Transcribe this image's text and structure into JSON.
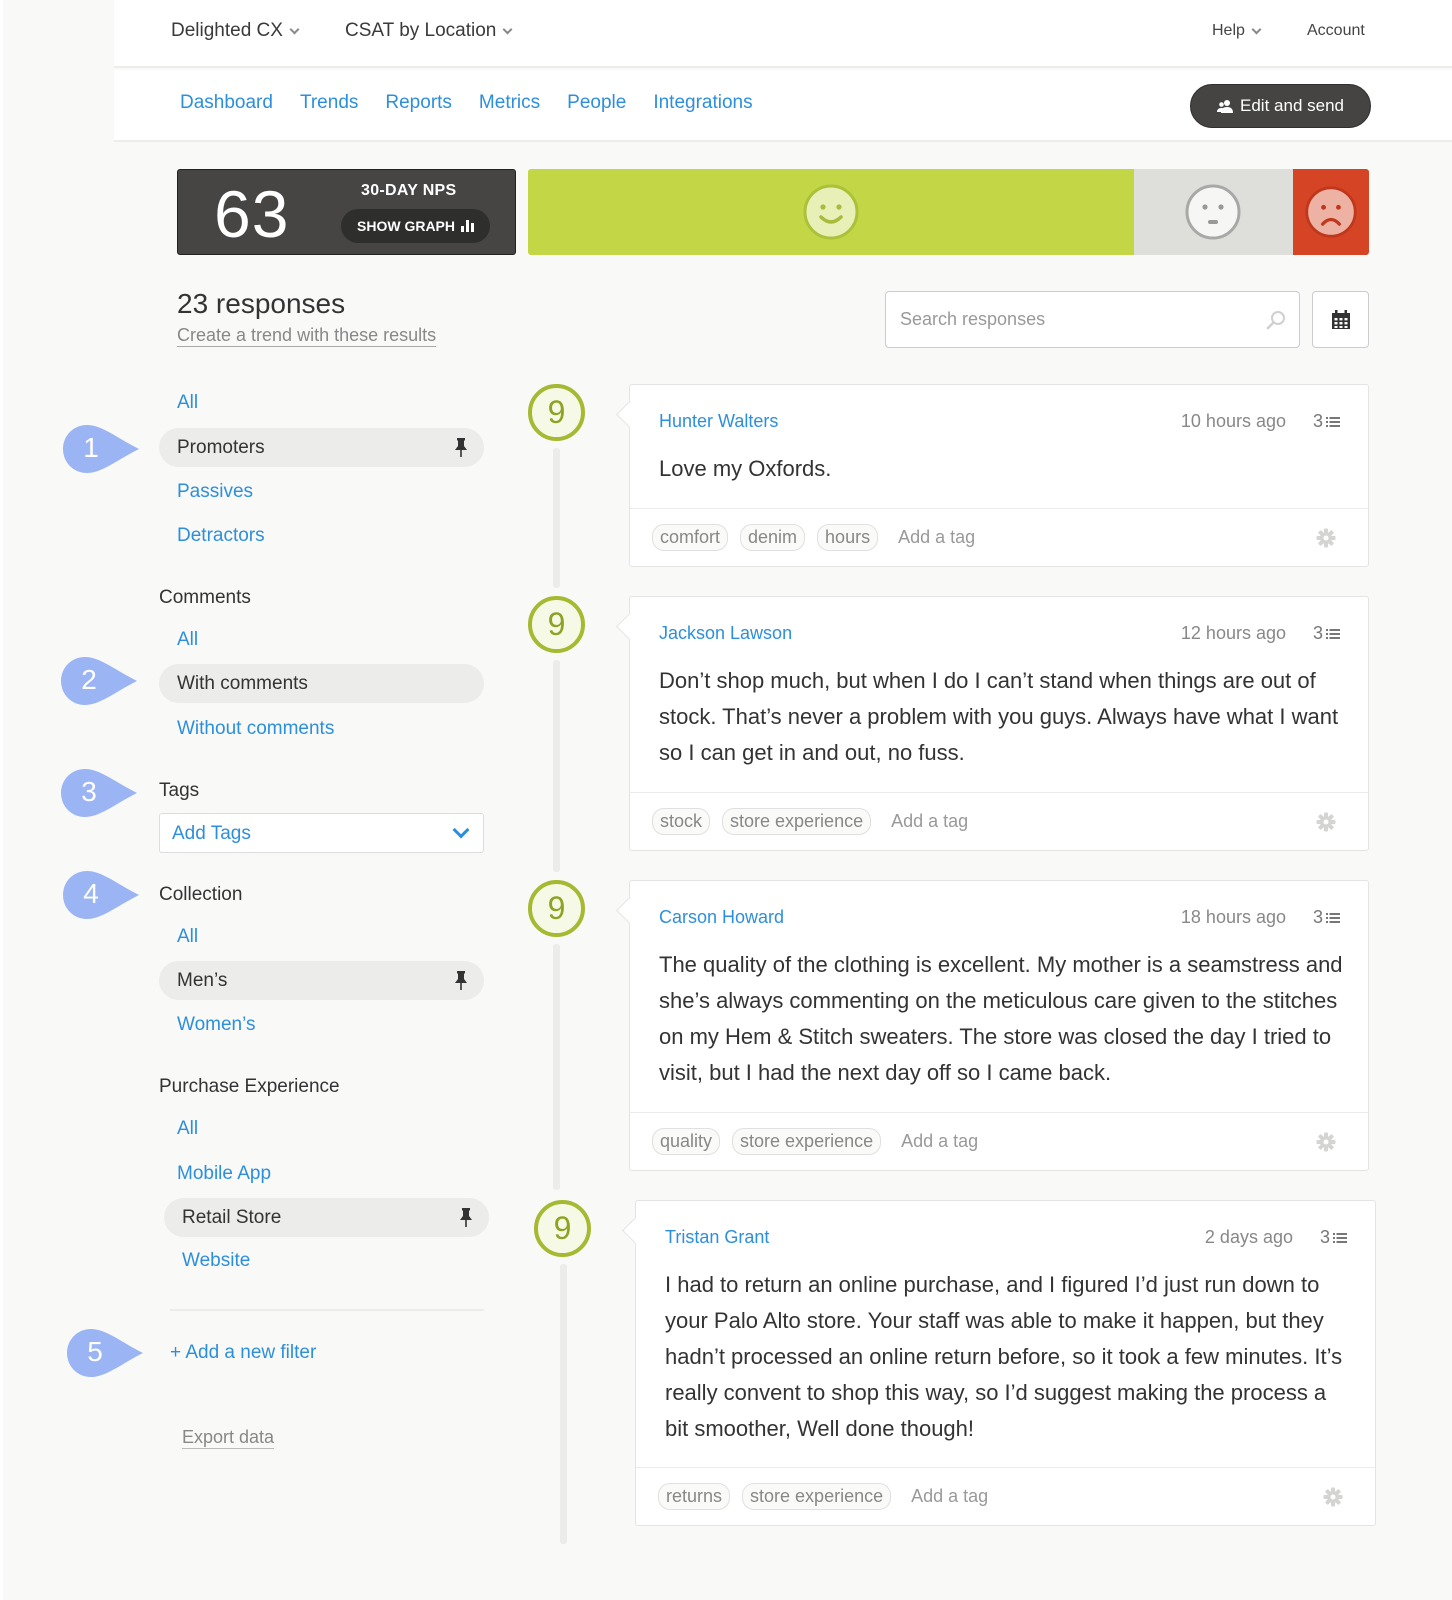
{
  "topbar": {
    "account_switcher": "Delighted CX",
    "project_switcher": "CSAT by Location",
    "help": "Help",
    "account": "Account"
  },
  "nav": {
    "links": [
      "Dashboard",
      "Trends",
      "Reports",
      "Metrics",
      "People",
      "Integrations"
    ],
    "edit_send": "Edit and send"
  },
  "nps": {
    "score": "63",
    "label": "30-DAY NPS",
    "show_graph": "SHOW GRAPH",
    "distribution": {
      "promoters_pct": 72,
      "passives_pct": 19,
      "detractors_pct": 9
    },
    "colors": {
      "promoters": "#c3d645",
      "passives": "#dededa",
      "detractors": "#d54425"
    }
  },
  "results": {
    "count_label": "23 responses",
    "trend_link": "Create a trend with these results",
    "search_placeholder": "Search responses"
  },
  "sidebar": {
    "score_filter": {
      "all": "All",
      "promoters": "Promoters",
      "passives": "Passives",
      "detractors": "Detractors"
    },
    "comments": {
      "heading": "Comments",
      "all": "All",
      "with": "With comments",
      "without": "Without comments"
    },
    "tags": {
      "heading": "Tags",
      "select": "Add Tags"
    },
    "collection": {
      "heading": "Collection",
      "all": "All",
      "mens": "Men’s",
      "womens": "Women’s"
    },
    "purchase": {
      "heading": "Purchase Experience",
      "all": "All",
      "mobile": "Mobile App",
      "retail": "Retail Store",
      "website": "Website"
    },
    "add_filter": "+ Add a new filter",
    "export": "Export data"
  },
  "markers": [
    "1",
    "2",
    "3",
    "4",
    "5"
  ],
  "responses": [
    {
      "score": "9",
      "name": "Hunter Walters",
      "time": "10 hours ago",
      "count": "3",
      "comment": "Love my Oxfords.",
      "tags": [
        "comfort",
        "denim",
        "hours"
      ],
      "add_tag": "Add a tag"
    },
    {
      "score": "9",
      "name": "Jackson Lawson",
      "time": "12 hours ago",
      "count": "3",
      "comment": "Don’t shop much, but when I do I can’t stand when things are out of stock. That’s never a problem with you guys. Always have what I want so I can get in and out, no fuss.",
      "tags": [
        "stock",
        "store experience"
      ],
      "add_tag": "Add a tag"
    },
    {
      "score": "9",
      "name": "Carson Howard",
      "time": "18 hours ago",
      "count": "3",
      "comment": "The quality of the clothing is excellent. My mother is a seamstress and she’s always commenting on the meticulous care given to the stitches on my Hem & Stitch sweaters. The store was closed the day I tried to visit, but I had the next day off so I came back.",
      "tags": [
        "quality",
        "store experience"
      ],
      "add_tag": "Add a tag"
    },
    {
      "score": "9",
      "name": "Tristan Grant",
      "time": "2 days ago",
      "count": "3",
      "comment": "I had to return an online purchase, and I figured I’d just run down to your Palo Alto store. Your staff was able to make it happen, but they hadn’t processed an online return before, so it took a few minutes. It’s really convent to shop this way, so I’d suggest making the process a bit smoother, Well done though!",
      "tags": [
        "returns",
        "store experience"
      ],
      "add_tag": "Add a tag"
    }
  ]
}
